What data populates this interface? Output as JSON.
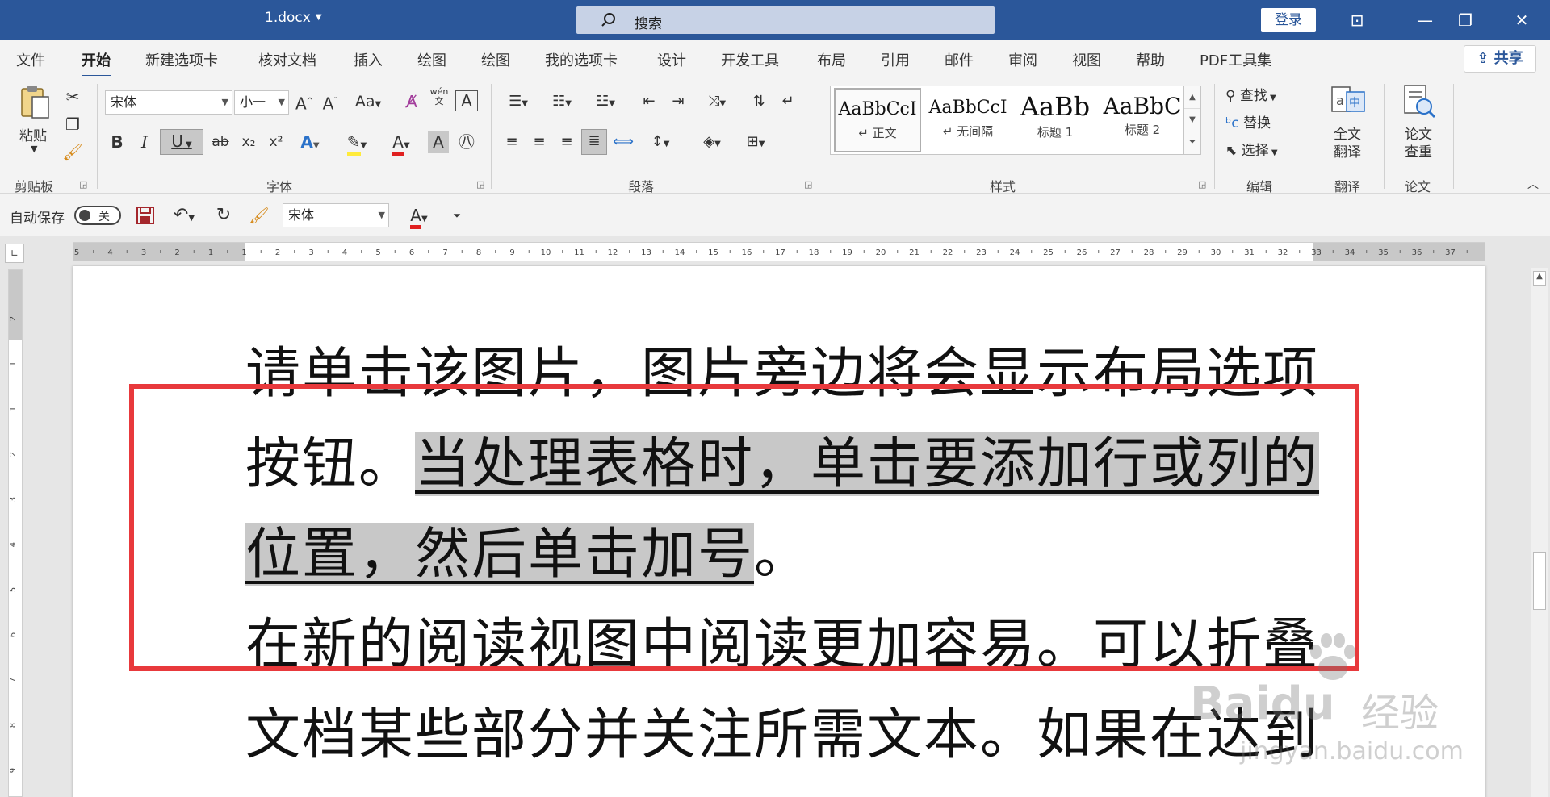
{
  "titlebar": {
    "doc_title": "1.docx",
    "search_label": "搜索",
    "login_label": "登录"
  },
  "menu": {
    "items": [
      "文件",
      "开始",
      "新建选项卡",
      "核对文档",
      "插入",
      "绘图",
      "绘图",
      "我的选项卡",
      "设计",
      "开发工具",
      "布局",
      "引用",
      "邮件",
      "审阅",
      "视图",
      "帮助",
      "PDF工具集"
    ],
    "active": "开始",
    "share_label": "共享"
  },
  "ribbon": {
    "clipboard": {
      "paste_label": "粘贴",
      "group_label": "剪贴板"
    },
    "font": {
      "font_name": "宋体",
      "font_size": "小一",
      "group_label": "字体",
      "grow_label": "A^",
      "shrink_label": "Aˇ",
      "case_label": "Aa",
      "bold": "B",
      "italic": "I",
      "underline": "U",
      "strike": "ab",
      "subscript": "x₂",
      "superscript": "x²",
      "phonetic": "wén\n文"
    },
    "paragraph": {
      "group_label": "段落"
    },
    "styles": {
      "group_label": "样式",
      "items": [
        {
          "sample": "AaBbCcI",
          "name": "↵ 正文"
        },
        {
          "sample": "AaBbCcI",
          "name": "↵ 无间隔"
        },
        {
          "sample": "AaBb",
          "name": "标题 1"
        },
        {
          "sample": "AaBbC",
          "name": "标题 2"
        }
      ]
    },
    "editing": {
      "group_label": "编辑",
      "find_label": "查找",
      "replace_label": "替换",
      "select_label": "选择"
    },
    "translate": {
      "group_label": "翻译",
      "button_line1": "全文",
      "button_line2": "翻译"
    },
    "thesis": {
      "group_label": "论文",
      "button_line1": "论文",
      "button_line2": "查重"
    }
  },
  "qat": {
    "autosave_label": "自动保存",
    "autosave_state": "关",
    "font_name": "宋体"
  },
  "ruler": {
    "h_ticks": [
      "5",
      "4",
      "3",
      "2",
      "1",
      "1",
      "2",
      "3",
      "4",
      "5",
      "6",
      "7",
      "8",
      "9",
      "10",
      "11",
      "12",
      "13",
      "14",
      "15",
      "16",
      "17",
      "18",
      "19",
      "20",
      "21",
      "22",
      "23",
      "24",
      "25",
      "26",
      "27",
      "28",
      "29",
      "30",
      "31",
      "32",
      "33",
      "34",
      "35",
      "36",
      "37"
    ],
    "v_ticks": [
      "2",
      "1",
      "1",
      "2",
      "3",
      "4",
      "5",
      "6",
      "7",
      "8",
      "9"
    ]
  },
  "document": {
    "para1_line1": "请单击该图片，图片旁边将会显示布局选项",
    "para1_line2_plain": "按钮。",
    "para1_line2_hl": "当处理表格时，单击要添加行或列的",
    "para1_line3_hl": "位置，然后单击加号",
    "para1_line3_plain": "。",
    "para2_line1": "在新的阅读视图中阅读更加容易。可以折叠",
    "para2_line2": "文档某些部分并关注所需文本。如果在达到"
  },
  "watermark": {
    "brand": "Baidu",
    "cn": "经验",
    "url": "jingyan.baidu.com"
  },
  "colors": {
    "titlebar": "#2b579a",
    "highlight": "#c8c8c8",
    "annotation_box": "#e8393c"
  }
}
